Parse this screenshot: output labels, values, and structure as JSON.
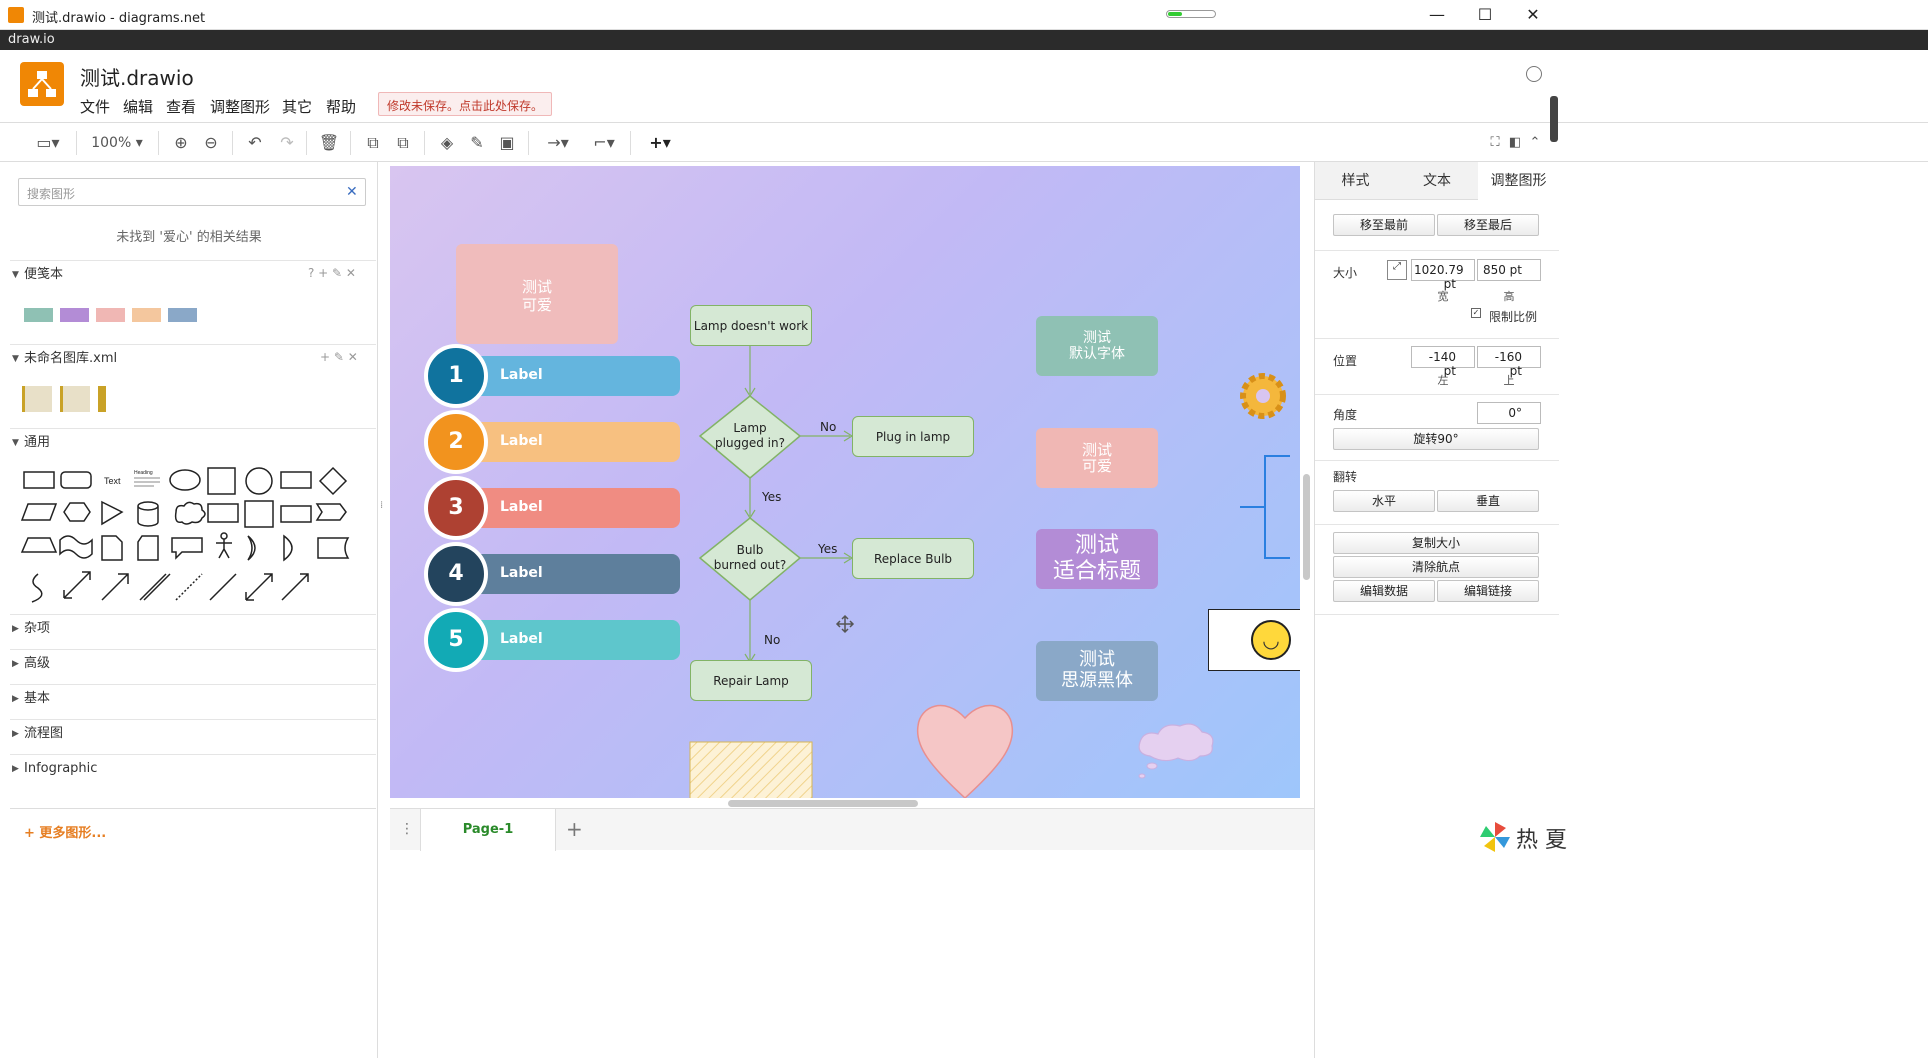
{
  "window": {
    "title": "测试.drawio - diagrams.net",
    "minimize": "—",
    "maximize": "☐",
    "close": "✕"
  },
  "app_bar": {
    "name": "draw.io"
  },
  "header": {
    "doc_title": "测试.drawio",
    "menu": [
      "文件",
      "编辑",
      "查看",
      "调整图形",
      "其它",
      "帮助"
    ],
    "unsaved_notice": "修改未保存。点击此处保存。"
  },
  "toolbar": {
    "zoom": "100%"
  },
  "left_panel": {
    "search_placeholder": "搜索图形",
    "no_result": "未找到 '爱心' 的相关结果",
    "sections": {
      "scratchpad": "便笺本",
      "library": "未命名图库.xml",
      "general": "通用",
      "misc": "杂项",
      "advanced": "高级",
      "basic": "基本",
      "flowchart": "流程图",
      "infographic": "Infographic"
    },
    "shape_text": "Text",
    "shape_heading": "Heading",
    "more_shapes": "+ 更多图形..."
  },
  "canvas": {
    "pink_box": [
      "测试",
      "可爱"
    ],
    "numbered": [
      {
        "num": "1",
        "label": "Label",
        "dark": "#10739e",
        "light": "#64b5de"
      },
      {
        "num": "2",
        "label": "Label",
        "dark": "#f2931e",
        "light": "#f7c080"
      },
      {
        "num": "3",
        "label": "Label",
        "dark": "#ae4132",
        "light": "#f08c82"
      },
      {
        "num": "4",
        "label": "Label",
        "dark": "#23445d",
        "light": "#5e7f9c"
      },
      {
        "num": "5",
        "label": "Label",
        "dark": "#12aab5",
        "light": "#5ec6cc"
      }
    ],
    "flowchart": {
      "start": "Lamp doesn't work",
      "q1": [
        "Lamp",
        "plugged in?"
      ],
      "no1": "No",
      "yes1": "Yes",
      "plug": "Plug in lamp",
      "q2": [
        "Bulb",
        "burned out?"
      ],
      "yes2": "Yes",
      "no2": "No",
      "replace": "Replace Bulb",
      "repair": "Repair Lamp"
    },
    "tags": [
      {
        "lines": [
          "测试",
          "默认字体"
        ],
        "color": "#8fc1b4"
      },
      {
        "lines": [
          "测试",
          "可爱"
        ],
        "color": "#f0b7b4"
      },
      {
        "lines": [
          "测试",
          "适合标题"
        ],
        "color": "#b38cd6"
      },
      {
        "lines": [
          "测试",
          "思源黑体"
        ],
        "color": "#8aa8c8"
      }
    ]
  },
  "page_tabs": {
    "current": "Page-1"
  },
  "right_panel": {
    "tabs": [
      "样式",
      "文本",
      "调整图形"
    ],
    "to_front": "移至最前",
    "to_back": "移至最后",
    "size_label": "大小",
    "width": "1020.79 pt",
    "height": "850 pt",
    "width_sub": "宽",
    "height_sub": "高",
    "constrain": "限制比例",
    "position_label": "位置",
    "left": "-140 pt",
    "top": "-160 pt",
    "left_sub": "左",
    "top_sub": "上",
    "angle_label": "角度",
    "angle": "0°",
    "rotate": "旋转90°",
    "flip_label": "翻转",
    "flip_h": "水平",
    "flip_v": "垂直",
    "copy_size": "复制大小",
    "clear_waypoints": "清除航点",
    "edit_data": "编辑数据",
    "edit_link": "编辑链接"
  },
  "watermark": "热 夏"
}
